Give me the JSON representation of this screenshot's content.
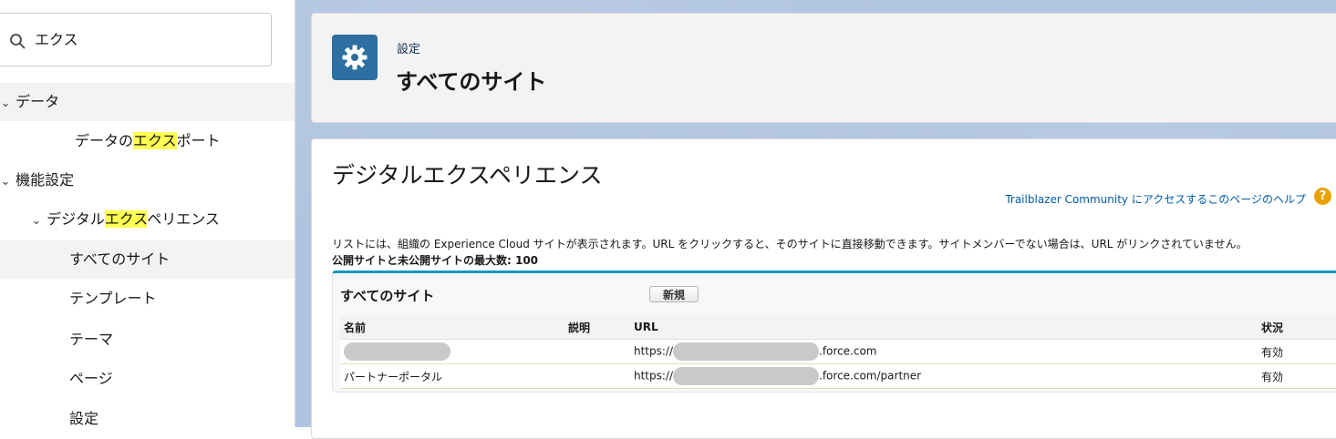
{
  "sidebar": {
    "search": {
      "value": "エクス"
    },
    "items": [
      {
        "prefix": "",
        "hl": "",
        "suffix": "データ"
      },
      {
        "prefix": "データの",
        "hl": "エクス",
        "suffix": "ポート"
      },
      {
        "prefix": "",
        "hl": "",
        "suffix": "機能設定"
      },
      {
        "prefix": "デジタル",
        "hl": "エクス",
        "suffix": "ペリエンス"
      },
      {
        "label": "すべてのサイト"
      },
      {
        "label": "テンプレート"
      },
      {
        "label": "テーマ"
      },
      {
        "label": "ページ"
      },
      {
        "label": "設定"
      }
    ],
    "colors": {
      "highlight": "#ffff54",
      "selected_bg": "#f3f3f3"
    }
  },
  "header": {
    "icon": "gear-icon",
    "breadcrumb": "設定",
    "title": "すべてのサイト",
    "icon_bg": "#2d6fa0"
  },
  "content": {
    "title": "デジタルエクスペリエンス",
    "help_link": "Trailblazer Community にアクセスするこのページのヘルプ",
    "help_icon": "?",
    "description": "リストには、組織の Experience Cloud サイトが表示されます。URL をクリックすると、そのサイトに直接移動できます。サイトメンバーでない場合は、URL がリンクされていません。",
    "max_sites": "公開サイトと未公開サイトの最大数: 100",
    "list": {
      "title": "すべてのサイト",
      "new_button": "新規",
      "columns": [
        "名前",
        "説明",
        "URL",
        "状況"
      ],
      "rows": [
        {
          "name": "",
          "description": "",
          "url_prefix": "https://",
          "url_suffix": ".force.com",
          "status": "有効"
        },
        {
          "name": "パートナーポータル",
          "description": "",
          "url_prefix": "https://",
          "url_suffix": ".force.com/partner",
          "status": "有効"
        }
      ]
    }
  }
}
